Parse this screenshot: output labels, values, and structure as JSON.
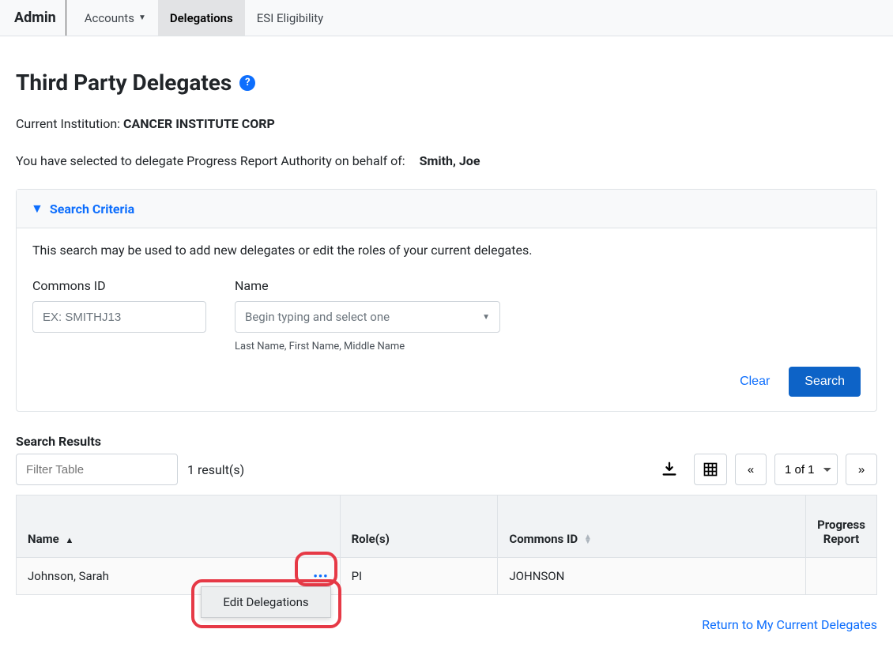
{
  "nav": {
    "brand": "Admin",
    "items": [
      {
        "label": "Accounts",
        "has_dropdown": true
      },
      {
        "label": "Delegations",
        "active": true
      },
      {
        "label": "ESI Eligibility"
      }
    ]
  },
  "page": {
    "title": "Third Party Delegates",
    "institution_label": "Current Institution:",
    "institution_value": "CANCER INSTITUTE CORP",
    "delegate_sentence": "You have selected to delegate Progress Report Authority on behalf of:",
    "delegate_person": "Smith, Joe"
  },
  "panel": {
    "header": "Search Criteria",
    "instruction": "This search may be used to add new delegates or edit the roles of your current delegates.",
    "commons_id_label": "Commons ID",
    "commons_id_placeholder": "EX: SMITHJ13",
    "name_label": "Name",
    "name_placeholder": "Begin typing and select one",
    "name_hint": "Last Name, First Name, Middle Name",
    "clear_label": "Clear",
    "search_label": "Search"
  },
  "results": {
    "header": "Search Results",
    "filter_placeholder": "Filter Table",
    "count_text": "1 result(s)",
    "page_select": "1 of 1",
    "prev": "«",
    "next": "»",
    "columns": {
      "name": "Name",
      "roles": "Role(s)",
      "commons_id": "Commons ID",
      "progress_report": "Progress Report"
    },
    "rows": [
      {
        "name": "Johnson, Sarah",
        "roles": "PI",
        "commons_id": "JOHNSON",
        "progress_report": ""
      }
    ],
    "row_menu": {
      "edit": "Edit Delegations"
    }
  },
  "footer": {
    "return_link": "Return to My Current Delegates"
  }
}
